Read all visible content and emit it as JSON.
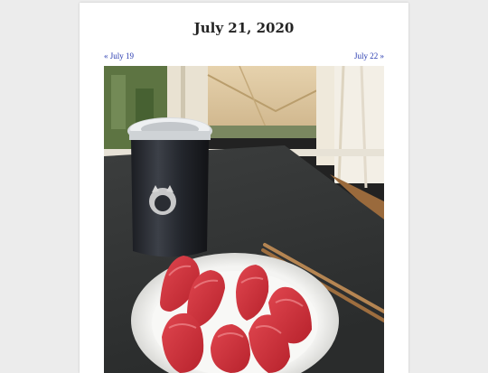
{
  "post": {
    "title": "July 21, 2020",
    "prev_link": "« July 19",
    "next_link": "July 22 »"
  },
  "photo": {
    "subject": "sushi-and-tumbler-photo"
  },
  "colors": {
    "page_background": "#ececec",
    "card_background": "#ffffff",
    "link": "#2a3cb0",
    "title": "#222222"
  }
}
